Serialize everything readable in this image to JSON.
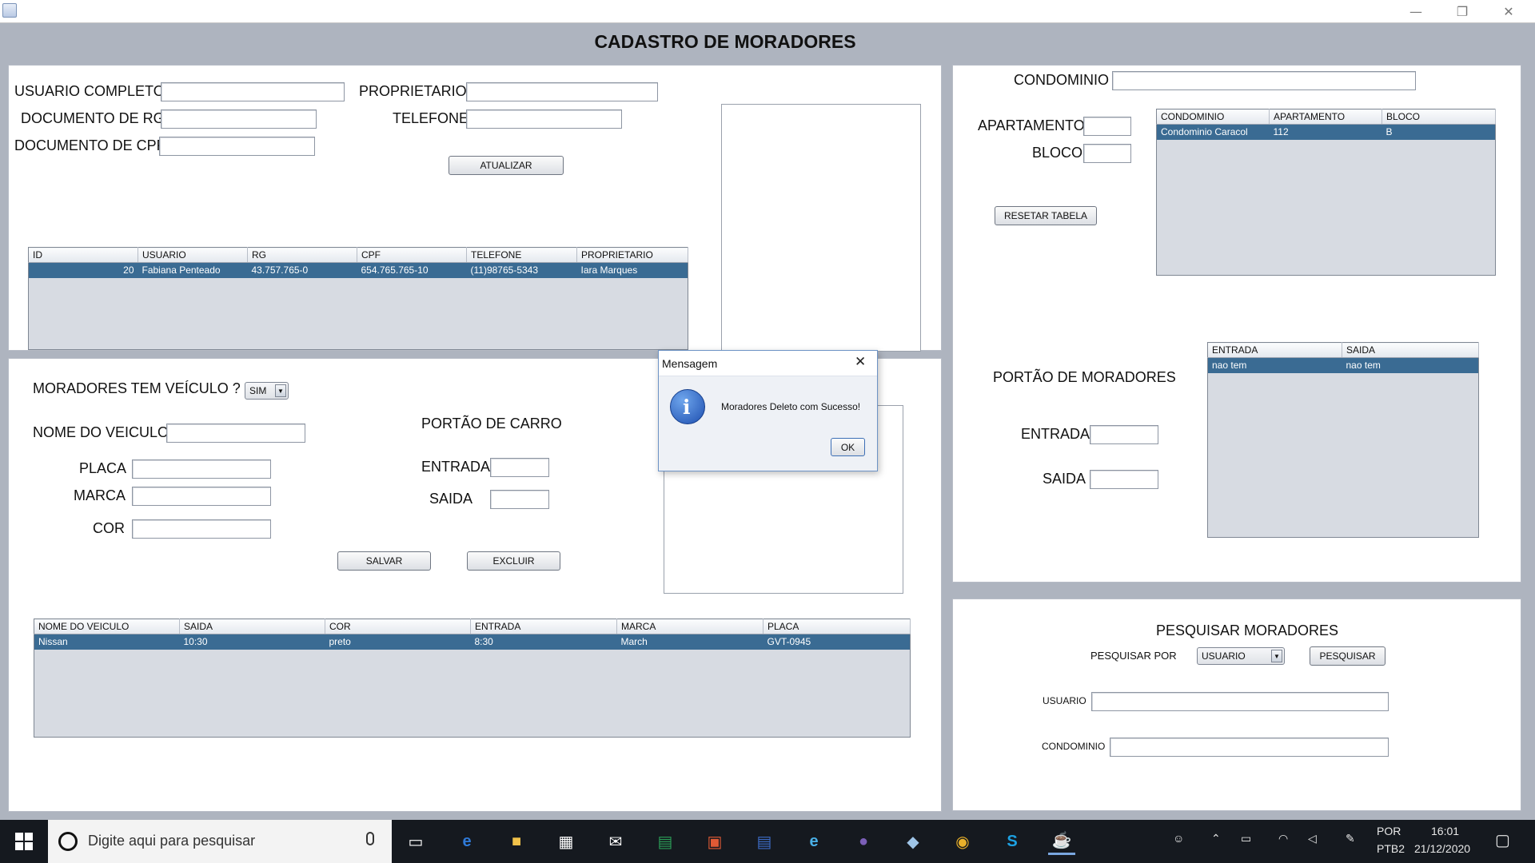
{
  "window": {
    "title": "CADASTRO DE MORADORES",
    "controls": {
      "minimize": "—",
      "restore": "❐",
      "close": "✕"
    }
  },
  "residents": {
    "fields": {
      "usuario_label": "USUARIO COMPLETO",
      "proprietario_label": "PROPRIETARIO",
      "rg_label": "DOCUMENTO DE RG",
      "telefone_label": "TELEFONE",
      "cpf_label": "DOCUMENTO DE CPF"
    },
    "update_button": "ATUALIZAR",
    "table": {
      "columns": [
        "ID",
        "USUARIO",
        "RG",
        "CPF",
        "TELEFONE",
        "PROPRIETARIO"
      ],
      "rows": [
        [
          "20",
          "Fabiana Penteado",
          "43.757.765-0",
          "654.765.765-10",
          "(11)98765-5343",
          "Iara Marques"
        ]
      ]
    }
  },
  "condo": {
    "condominio_label": "CONDOMINIO",
    "apartamento_label": "APARTAMENTO",
    "bloco_label": "BLOCO",
    "reset_button": "RESETAR TABELA",
    "table": {
      "columns": [
        "CONDOMINIO",
        "APARTAMENTO",
        "BLOCO"
      ],
      "rows": [
        [
          "Condominio Caracol",
          "112",
          "B"
        ]
      ]
    }
  },
  "resident_gate": {
    "title": "PORTÃO DE MORADORES",
    "entrada_label": "ENTRADA",
    "saida_label": "SAIDA",
    "table": {
      "columns": [
        "ENTRADA",
        "SAIDA"
      ],
      "rows": [
        [
          "nao tem",
          "nao tem"
        ]
      ]
    }
  },
  "vehicle": {
    "has_vehicle_label": "MORADORES TEM VEÍCULO ?",
    "has_vehicle_value": "SIM",
    "nome_label": "NOME DO VEICULO",
    "placa_label": "PLACA",
    "marca_label": "MARCA",
    "cor_label": "COR",
    "gate_title": "PORTÃO DE CARRO",
    "entrada_label": "ENTRADA",
    "saida_label": "SAIDA",
    "save_button": "SALVAR",
    "delete_button": "EXCLUIR",
    "table": {
      "columns": [
        "NOME DO VEICULO",
        "SAIDA",
        "COR",
        "ENTRADA",
        "MARCA",
        "PLACA"
      ],
      "rows": [
        [
          "Nissan",
          "10:30",
          "preto",
          "8:30",
          "March",
          "GVT-0945"
        ]
      ]
    }
  },
  "search": {
    "title": "PESQUISAR MORADORES",
    "by_label": "PESQUISAR POR",
    "by_value": "USUARIO",
    "search_button": "PESQUISAR",
    "usuario_label": "USUARIO",
    "condominio_label": "CONDOMINIO"
  },
  "dialog": {
    "title": "Mensagem",
    "message": "Moradores Deleto com Sucesso!",
    "ok": "OK",
    "close": "✕"
  },
  "taskbar": {
    "search_placeholder": "Digite aqui para pesquisar",
    "language": "POR",
    "layout": "PTB2",
    "time": "16:01",
    "date": "21/12/2020"
  }
}
